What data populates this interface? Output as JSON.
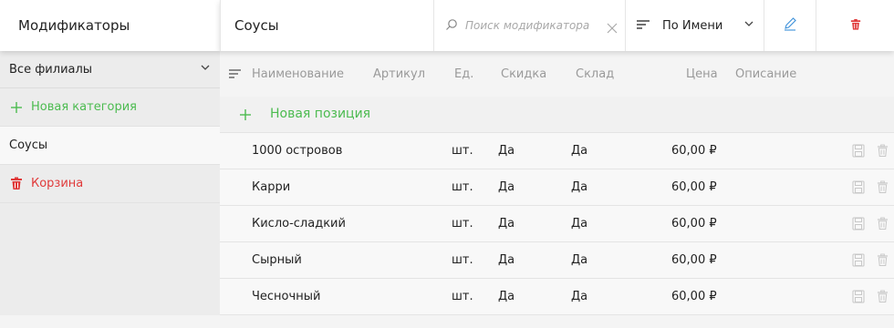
{
  "sidebar": {
    "title": "Модификаторы",
    "branch": "Все филиалы",
    "new_category": "Новая категория",
    "category": "Соусы",
    "trash": "Корзина"
  },
  "header": {
    "title": "Соусы",
    "search_placeholder": "Поиск модификатора",
    "sort_label": "По Имени"
  },
  "table": {
    "columns": [
      "Наименование",
      "Артикул",
      "Ед.",
      "Скидка",
      "Склад",
      "Цена",
      "Описание"
    ],
    "new_position": "Новая позиция",
    "rows": [
      {
        "name": "1000 островов",
        "article": "",
        "unit": "шт.",
        "discount": "Да",
        "stock": "Да",
        "price": "60,00 ₽",
        "description": ""
      },
      {
        "name": "Карри",
        "article": "",
        "unit": "шт.",
        "discount": "Да",
        "stock": "Да",
        "price": "60,00 ₽",
        "description": ""
      },
      {
        "name": "Кисло-сладкий",
        "article": "",
        "unit": "шт.",
        "discount": "Да",
        "stock": "Да",
        "price": "60,00 ₽",
        "description": ""
      },
      {
        "name": "Сырный",
        "article": "",
        "unit": "шт.",
        "discount": "Да",
        "stock": "Да",
        "price": "60,00 ₽",
        "description": ""
      },
      {
        "name": "Чесночный",
        "article": "",
        "unit": "шт.",
        "discount": "Да",
        "stock": "Да",
        "price": "60,00 ₽",
        "description": ""
      }
    ]
  },
  "colors": {
    "accent_green": "#4cbb50",
    "danger_red": "#e03a3a",
    "edit_blue": "#3a8fd9"
  }
}
